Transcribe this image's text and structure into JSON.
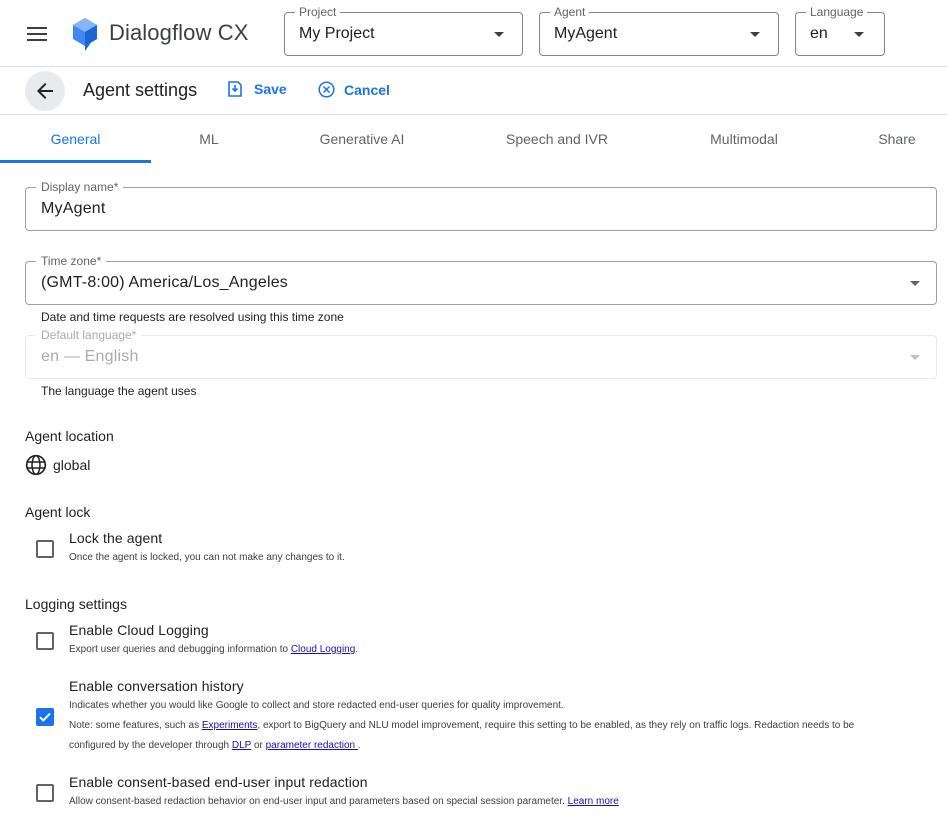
{
  "header": {
    "brand": "Dialogflow CX",
    "project": {
      "label": "Project",
      "value": "My Project"
    },
    "agent": {
      "label": "Agent",
      "value": "MyAgent"
    },
    "language": {
      "label": "Language",
      "value": "en"
    }
  },
  "actions": {
    "title": "Agent settings",
    "save": "Save",
    "cancel": "Cancel"
  },
  "tabs": [
    {
      "label": "General",
      "active": true
    },
    {
      "label": "ML"
    },
    {
      "label": "Generative AI"
    },
    {
      "label": "Speech and IVR"
    },
    {
      "label": "Multimodal"
    },
    {
      "label": "Share"
    }
  ],
  "form": {
    "display_name": {
      "label": "Display name*",
      "value": "MyAgent"
    },
    "time_zone": {
      "label": "Time zone*",
      "value": "(GMT-8:00) America/Los_Angeles",
      "hint": "Date and time requests are resolved using this time zone"
    },
    "default_language": {
      "label": "Default language*",
      "value": "en — English",
      "hint": "The language the agent uses"
    }
  },
  "location": {
    "heading": "Agent location",
    "value": "global"
  },
  "lock": {
    "heading": "Agent lock",
    "title": "Lock the agent",
    "desc": "Once the agent is locked, you can not make any changes to it.",
    "checked": false
  },
  "logging": {
    "heading": "Logging settings",
    "cloud": {
      "title": "Enable Cloud Logging",
      "desc_pre": "Export user queries and debugging information to ",
      "desc_link": "Cloud Logging",
      "desc_post": ".",
      "checked": false
    },
    "history": {
      "title": "Enable conversation history",
      "desc1": "Indicates whether you would like Google to collect and store redacted end-user queries for quality improvement.",
      "desc2_pre": "Note: some features, such as ",
      "desc2_link": "Experiments",
      "desc2_post": ", export to BigQuery and NLU model improvement, require this setting to be enabled, as they rely on traffic logs. Redaction needs to be",
      "desc3_pre": "configured by the developer through ",
      "desc3_link1": "DLP",
      "desc3_mid": " or ",
      "desc3_link2": "parameter redaction ",
      "desc3_post": ".",
      "checked": true
    },
    "consent": {
      "title": "Enable consent-based end-user input redaction",
      "desc_pre": "Allow consent-based redaction behavior on end-user input and parameters based on special session parameter. ",
      "desc_link": "Learn more",
      "checked": false
    }
  },
  "colors": {
    "accent": "#1a73e8",
    "link": "#1a0dab"
  }
}
